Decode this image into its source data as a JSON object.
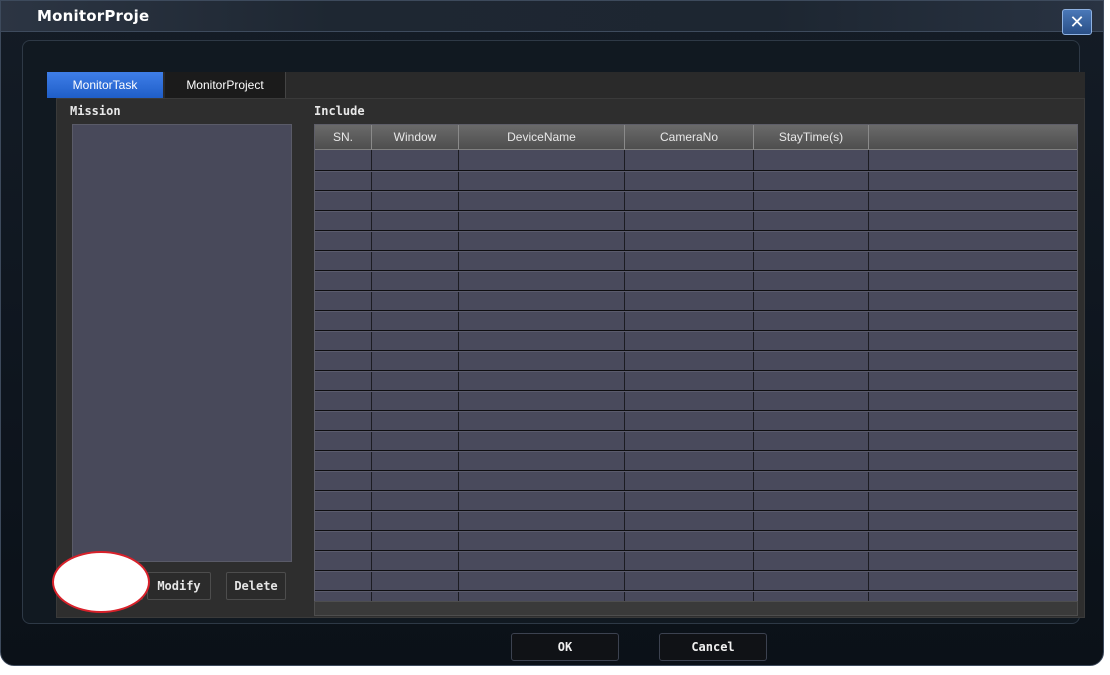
{
  "window": {
    "title": "MonitorProje",
    "close_icon": "close-icon"
  },
  "tabs": [
    {
      "label": "MonitorTask",
      "active": true
    },
    {
      "label": "MonitorProject",
      "active": false
    }
  ],
  "mission": {
    "label": "Mission",
    "items": [],
    "buttons": {
      "modify": "Modify",
      "delete": "Delete"
    }
  },
  "include": {
    "label": "Include",
    "columns": [
      "SN.",
      "Window",
      "DeviceName",
      "CameraNo",
      "StayTime(s)",
      ""
    ],
    "rows": []
  },
  "footer": {
    "ok": "OK",
    "cancel": "Cancel"
  },
  "colors": {
    "active_tab": "#2a6ad6",
    "list_bg": "#48495a",
    "redaction_border": "#d8212a"
  }
}
